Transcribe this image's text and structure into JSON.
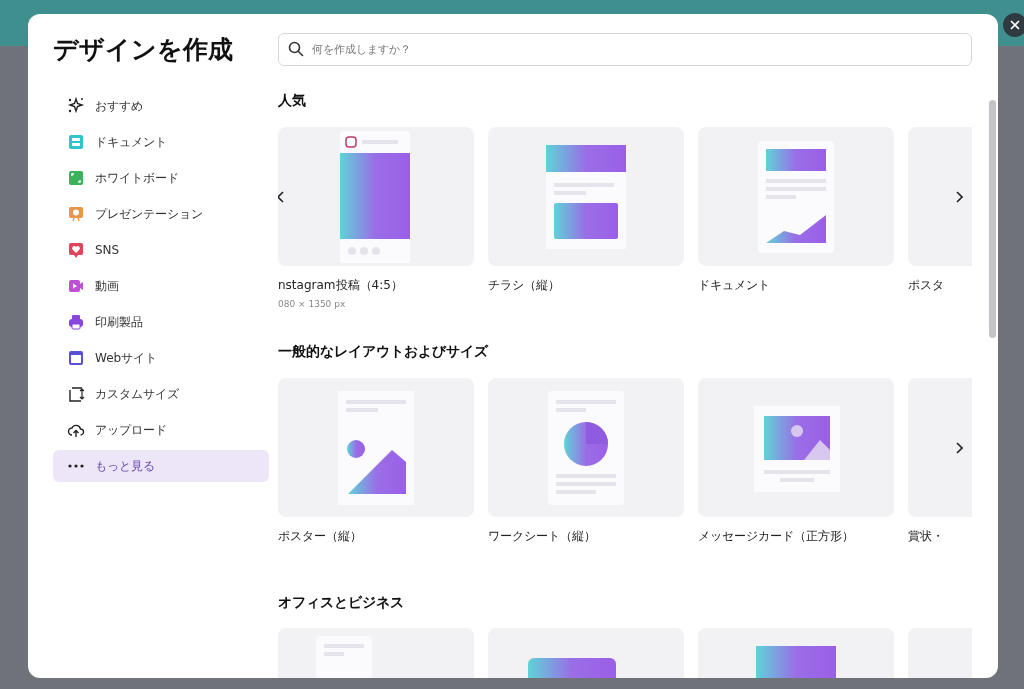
{
  "dialog": {
    "title": "デザインを作成"
  },
  "search": {
    "placeholder": "何を作成しますか？"
  },
  "sidebar": {
    "items": [
      {
        "label": "おすすめ",
        "selected": false
      },
      {
        "label": "ドキュメント",
        "selected": false
      },
      {
        "label": "ホワイトボード",
        "selected": false
      },
      {
        "label": "プレゼンテーション",
        "selected": false
      },
      {
        "label": "SNS",
        "selected": false
      },
      {
        "label": "動画",
        "selected": false
      },
      {
        "label": "印刷製品",
        "selected": false
      },
      {
        "label": "Webサイト",
        "selected": false
      },
      {
        "label": "カスタムサイズ",
        "selected": false
      },
      {
        "label": "アップロード",
        "selected": false
      },
      {
        "label": "もっと見る",
        "selected": true
      }
    ]
  },
  "sections": [
    {
      "heading": "人気",
      "prev_arrow": true,
      "next_arrow": true,
      "cards": [
        {
          "kind": "social",
          "name": "nstagram投稿（4:5）",
          "size": "080 × 1350 px"
        },
        {
          "kind": "flyer",
          "name": "チラシ（縦）"
        },
        {
          "kind": "document",
          "name": "ドキュメント"
        },
        {
          "kind": "blank",
          "name": "ポスタ"
        }
      ]
    },
    {
      "heading": "一般的なレイアウトおよびサイズ",
      "next_arrow": true,
      "cards": [
        {
          "kind": "poster",
          "name": "ポスター（縦）"
        },
        {
          "kind": "worksheet",
          "name": "ワークシート（縦）"
        },
        {
          "kind": "card",
          "name": "メッセージカード（正方形）"
        },
        {
          "kind": "blank",
          "name": "賞状・"
        }
      ]
    },
    {
      "heading": "オフィスとビジネス",
      "cards": [
        {
          "kind": "letter"
        },
        {
          "kind": "banner"
        },
        {
          "kind": "report"
        },
        {
          "kind": "blank"
        }
      ]
    }
  ]
}
